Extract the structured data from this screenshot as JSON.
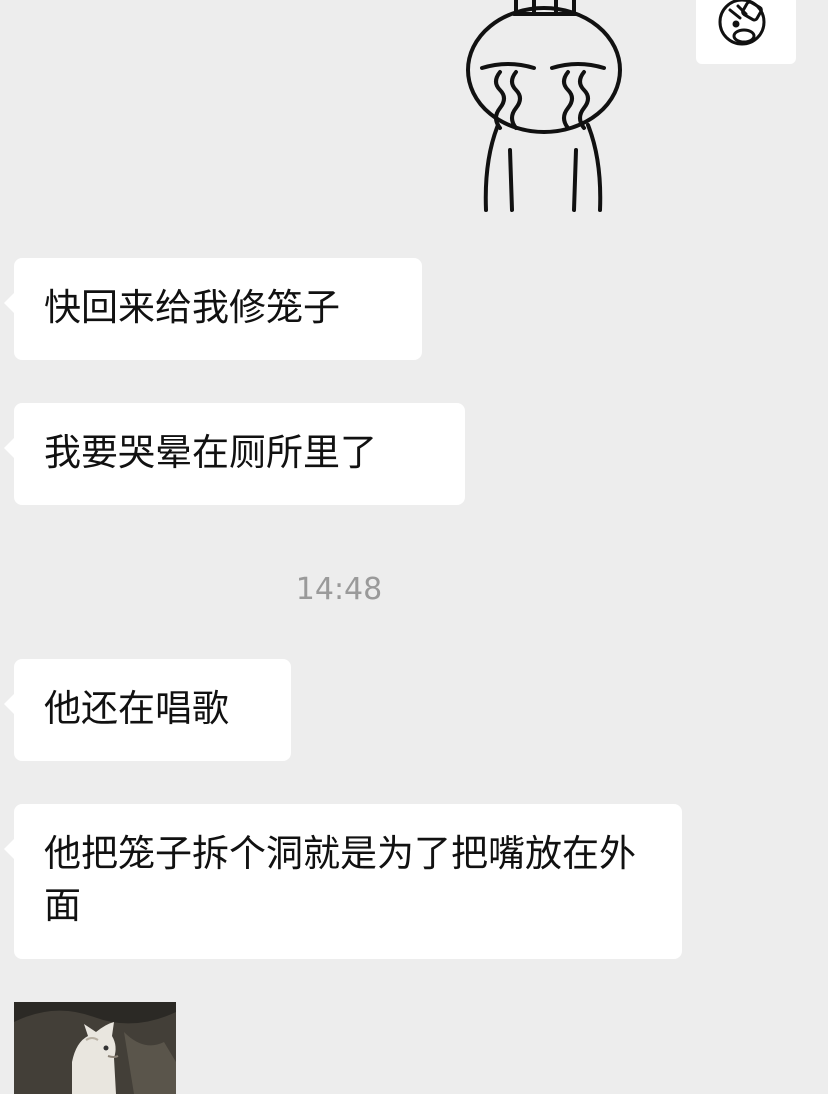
{
  "chat": {
    "messages": [
      {
        "text": "快回来给我修笼子"
      },
      {
        "text": "我要哭晕在厕所里了"
      },
      {
        "text": "他还在唱歌"
      },
      {
        "text": "他把笼子拆个洞就是为了把嘴放在外面"
      }
    ],
    "timestamp": "14:48",
    "stickers": [
      {
        "icon": "crying-bunny-sticker"
      },
      {
        "icon": "bandaged-face-avatar-icon"
      }
    ],
    "image_message": {
      "icon": "cat-photo-thumbnail"
    }
  },
  "colors": {
    "background": "#ededed",
    "bubble": "#ffffff",
    "text": "#111111",
    "timestamp": "#9a9a9a"
  }
}
